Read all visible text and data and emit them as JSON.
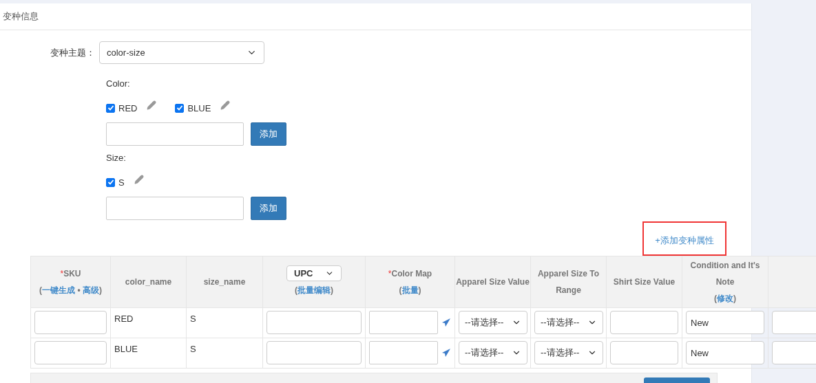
{
  "panel": {
    "title": "变种信息"
  },
  "theme": {
    "label": "变种主题：",
    "value": "color-size"
  },
  "attributes": [
    {
      "label": "Color:",
      "button": "添加",
      "options": [
        {
          "label": "RED",
          "checked": true
        },
        {
          "label": "BLUE",
          "checked": true
        }
      ]
    },
    {
      "label": "Size:",
      "button": "添加",
      "options": [
        {
          "label": "S",
          "checked": true
        }
      ]
    }
  ],
  "add_attribute_link": {
    "text": "+添加变种属性",
    "highlighted": true
  },
  "table": {
    "columns": [
      {
        "kind": "text",
        "label": "SKU",
        "mark": "*",
        "sub": [
          {
            "kind": "text",
            "text": "("
          },
          {
            "kind": "link",
            "text": "一键生成"
          },
          {
            "kind": "text",
            "text": " • "
          },
          {
            "kind": "link",
            "text": "高级"
          },
          {
            "kind": "text",
            "text": ")"
          }
        ]
      },
      {
        "kind": "text",
        "label": "color_name"
      },
      {
        "kind": "text",
        "label": "size_name"
      },
      {
        "kind": "select",
        "label": "UPC",
        "sub": [
          {
            "kind": "text",
            "text": "("
          },
          {
            "kind": "link",
            "text": "批量编辑"
          },
          {
            "kind": "text",
            "text": ")"
          }
        ]
      },
      {
        "kind": "text",
        "label": "Color Map",
        "mark": "*",
        "sub": [
          {
            "kind": "text",
            "text": "("
          },
          {
            "kind": "link",
            "text": "批量"
          },
          {
            "kind": "text",
            "text": ")"
          }
        ]
      },
      {
        "kind": "text",
        "label": "Apparel Size Value"
      },
      {
        "kind": "text",
        "label": "Apparel Size To Range"
      },
      {
        "kind": "text",
        "label": "Shirt Size Value"
      },
      {
        "kind": "text",
        "label": "Condition and It's Note",
        "sub": [
          {
            "kind": "text",
            "text": "("
          },
          {
            "kind": "link",
            "text": "修改"
          },
          {
            "kind": "text",
            "text": ")"
          }
        ]
      }
    ],
    "rows": [
      {
        "cells": [
          {
            "kind": "input"
          },
          {
            "kind": "text",
            "text": "RED"
          },
          {
            "kind": "text",
            "text": "S"
          },
          {
            "kind": "input"
          },
          {
            "kind": "input_send"
          },
          {
            "kind": "select",
            "value": "--请选择--"
          },
          {
            "kind": "select",
            "value": "--请选择--"
          },
          {
            "kind": "input"
          },
          {
            "kind": "input",
            "value": "New"
          },
          {
            "kind": "input"
          }
        ]
      },
      {
        "cells": [
          {
            "kind": "input"
          },
          {
            "kind": "text",
            "text": "BLUE"
          },
          {
            "kind": "text",
            "text": "S"
          },
          {
            "kind": "input"
          },
          {
            "kind": "input_send"
          },
          {
            "kind": "select",
            "value": "--请选择--"
          },
          {
            "kind": "select",
            "value": "--请选择--"
          },
          {
            "kind": "input"
          },
          {
            "kind": "input",
            "value": "New"
          },
          {
            "kind": "input"
          }
        ]
      }
    ]
  }
}
